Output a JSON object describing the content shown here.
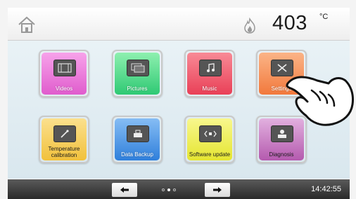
{
  "header": {
    "temperature": "403",
    "unit": "°C"
  },
  "tiles": [
    {
      "label": "Videos",
      "color": "#e85ed2"
    },
    {
      "label": "Pictures",
      "color": "#37d47e"
    },
    {
      "label": "Music",
      "color": "#f14f63"
    },
    {
      "label": "Settings",
      "color": "#f5884e"
    },
    {
      "label": "Temperature calibration",
      "color": "#f4cc55"
    },
    {
      "label": "Data Backup",
      "color": "#3b8ee6"
    },
    {
      "label": "Software update",
      "color": "#eded4a"
    },
    {
      "label": "Diagnosis",
      "color": "#c06dbb"
    }
  ],
  "footer": {
    "time": "14:42:55",
    "page_dots": 3,
    "active_page": 2
  }
}
